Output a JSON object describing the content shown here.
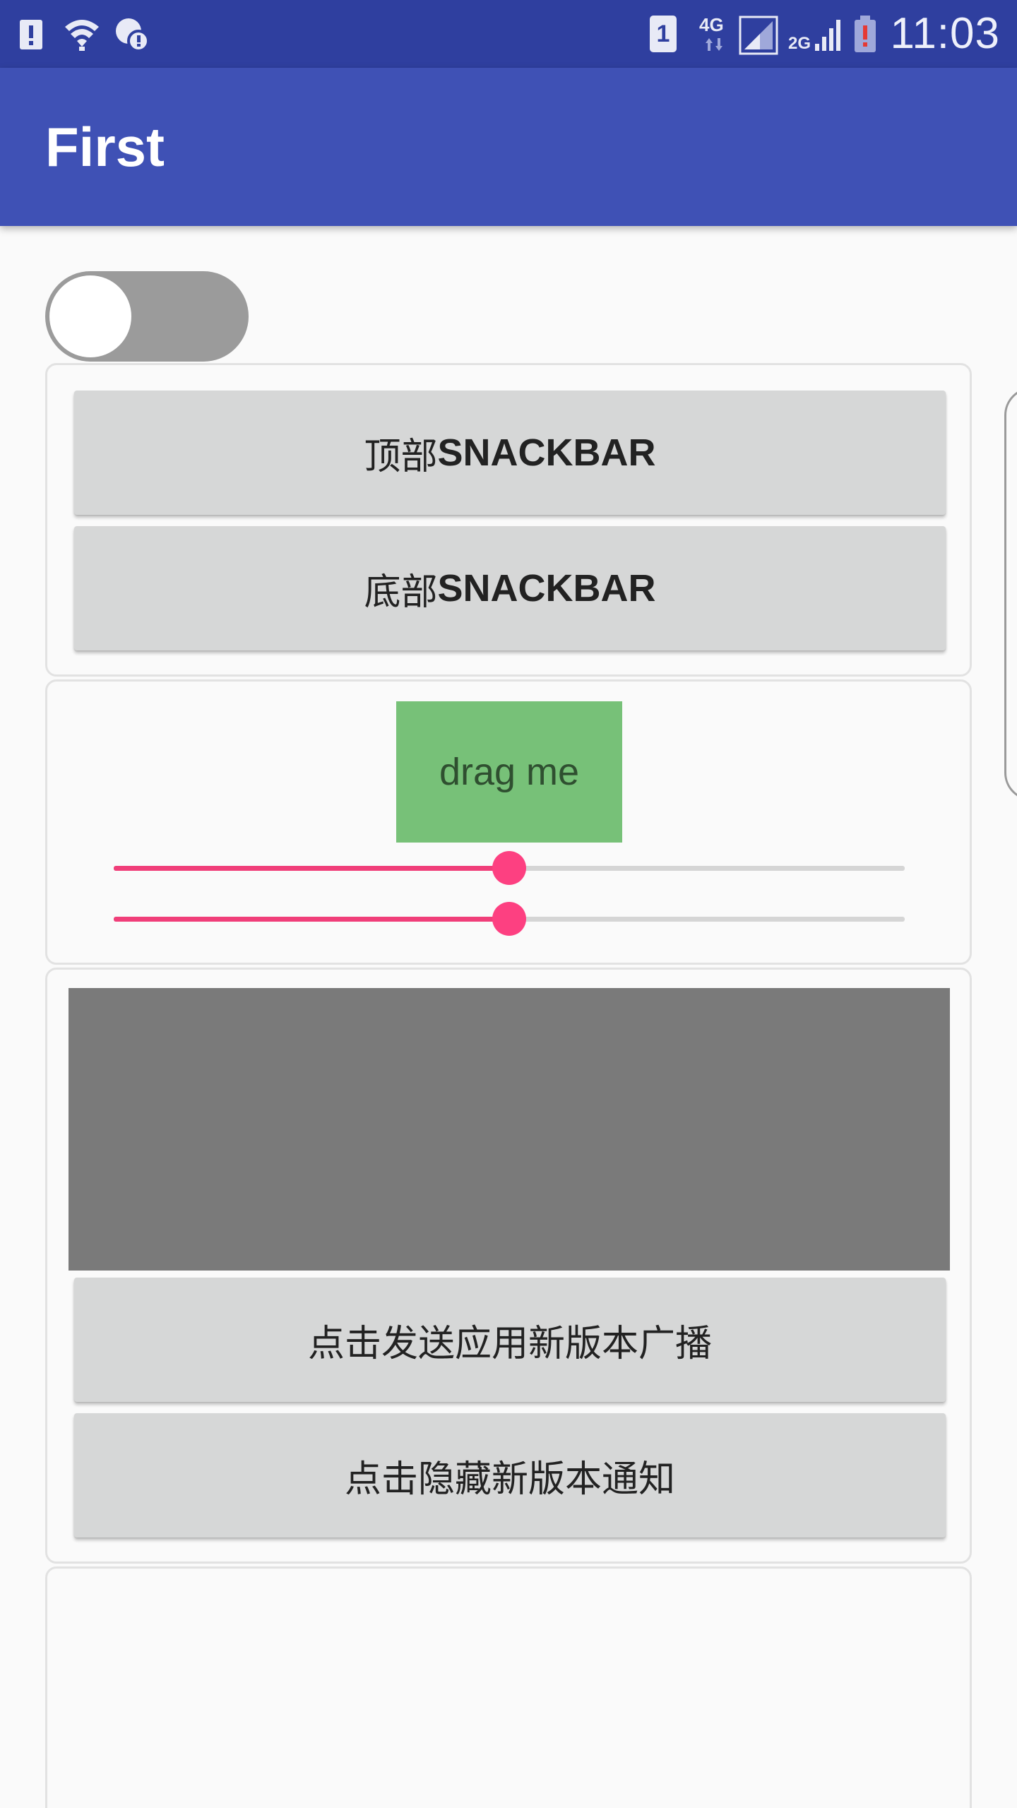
{
  "status_bar": {
    "time": "11:03",
    "sim_slot": "1",
    "network_4g": "4G",
    "network_2g": "2G",
    "icons": [
      "alert-icon",
      "wifi-icon",
      "location-alert-icon",
      "sim-1-icon",
      "signal-icon",
      "battery-low-icon"
    ]
  },
  "app_bar": {
    "title": "First"
  },
  "switch": {
    "checked": false
  },
  "snackbar_card": {
    "top_button": {
      "cn": "顶部",
      "en": "SNACKBAR"
    },
    "bottom_button": {
      "cn": "底部",
      "en": "SNACKBAR"
    }
  },
  "drag_card": {
    "drag_label": "drag me",
    "slider1_value": 0.5,
    "slider2_value": 0.5,
    "colors": {
      "accent": "#ff4081",
      "drag_box": "#77c178"
    }
  },
  "broadcast_card": {
    "send_button": "点击发送应用新版本广播",
    "hide_button": "点击隐藏新版本通知"
  },
  "colors": {
    "primary": "#3f51b5",
    "primary_dark": "#303f9f"
  }
}
